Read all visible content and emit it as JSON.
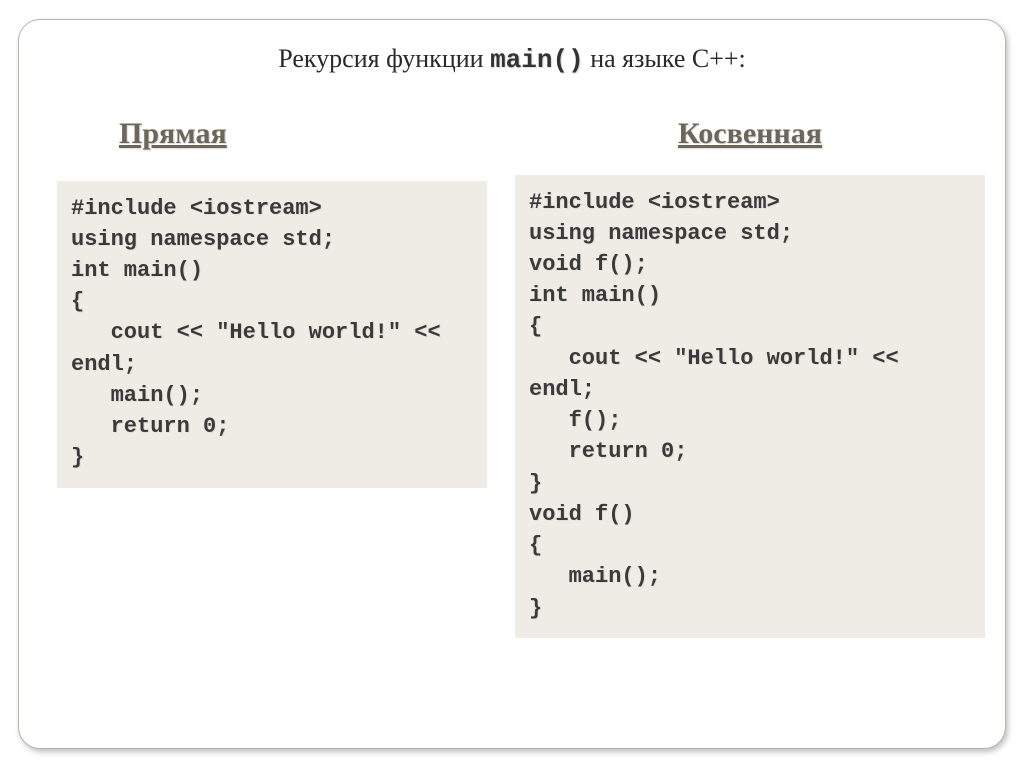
{
  "title": {
    "before": "Рекурсия функции ",
    "mono": "main()",
    "after": "  на языке С++:"
  },
  "left": {
    "heading": "Прямая",
    "code": "#include <iostream>\nusing namespace std;\nint main()\n{\n   cout << \"Hello world!\" << endl;\n   main();\n   return 0;\n}"
  },
  "right": {
    "heading": "Косвенная",
    "code": "#include <iostream>\nusing namespace std;\nvoid f();\nint main()\n{\n   cout << \"Hello world!\" << endl;\n   f();\n   return 0;\n}\nvoid f()\n{\n   main();\n}"
  }
}
